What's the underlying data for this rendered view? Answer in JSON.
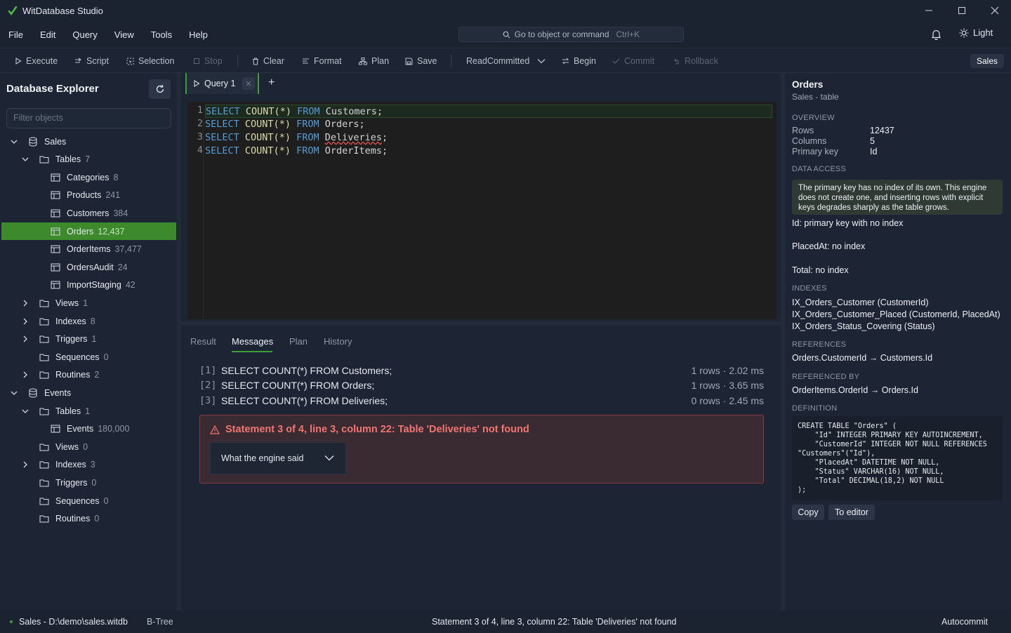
{
  "app": {
    "title": "WitDatabase Studio"
  },
  "menu": [
    "File",
    "Edit",
    "Query",
    "View",
    "Tools",
    "Help"
  ],
  "command_search": {
    "label": "Go to object or command",
    "shortcut": "Ctrl+K"
  },
  "theme_toggle": {
    "label": "Light"
  },
  "toolbar": {
    "execute": "Execute",
    "script": "Script",
    "selection": "Selection",
    "stop": "Stop",
    "clear": "Clear",
    "format": "Format",
    "plan": "Plan",
    "save": "Save",
    "isolation": "ReadCommitted",
    "begin": "Begin",
    "commit": "Commit",
    "rollback": "Rollback",
    "database_badge": "Sales"
  },
  "explorer": {
    "title": "Database Explorer",
    "filter_placeholder": "Filter objects",
    "tree": [
      {
        "label": "Sales",
        "count": ""
      },
      {
        "label": "Tables",
        "count": "7"
      },
      {
        "label": "Categories",
        "count": "8"
      },
      {
        "label": "Products",
        "count": "241"
      },
      {
        "label": "Customers",
        "count": "384"
      },
      {
        "label": "Orders",
        "count": "12,437"
      },
      {
        "label": "OrderItems",
        "count": "37,477"
      },
      {
        "label": "OrdersAudit",
        "count": "24"
      },
      {
        "label": "ImportStaging",
        "count": "42"
      },
      {
        "label": "Views",
        "count": "1"
      },
      {
        "label": "Indexes",
        "count": "8"
      },
      {
        "label": "Triggers",
        "count": "1"
      },
      {
        "label": "Sequences",
        "count": "0"
      },
      {
        "label": "Routines",
        "count": "2"
      },
      {
        "label": "Events",
        "count": ""
      },
      {
        "label": "Tables",
        "count": "1"
      },
      {
        "label": "Events",
        "count": "180,000"
      },
      {
        "label": "Views",
        "count": "0"
      },
      {
        "label": "Indexes",
        "count": "3"
      },
      {
        "label": "Triggers",
        "count": "0"
      },
      {
        "label": "Sequences",
        "count": "0"
      },
      {
        "label": "Routines",
        "count": "0"
      }
    ]
  },
  "editor": {
    "tab_label": "Query 1",
    "line_numbers": [
      "1",
      "2",
      "3",
      "4"
    ],
    "lines": [
      {
        "kw1": "SELECT",
        "fn": "COUNT(*)",
        "kw2": "FROM",
        "table": "Customers",
        "end": ";"
      },
      {
        "kw1": "SELECT",
        "fn": "COUNT(*)",
        "kw2": "FROM",
        "table": "Orders",
        "end": ";"
      },
      {
        "kw1": "SELECT",
        "fn": "COUNT(*)",
        "kw2": "FROM",
        "table": "Deliveries",
        "end": ";"
      },
      {
        "kw1": "SELECT",
        "fn": "COUNT(*)",
        "kw2": "FROM",
        "table": "OrderItems",
        "end": ";"
      }
    ]
  },
  "results": {
    "tabs": [
      "Result",
      "Messages",
      "Plan",
      "History"
    ],
    "messages": [
      {
        "idx": "[1]",
        "sql": "SELECT COUNT(*) FROM Customers;",
        "meta": "1 rows · 2.02 ms"
      },
      {
        "idx": "[2]",
        "sql": "SELECT COUNT(*) FROM Orders;",
        "meta": "1 rows · 3.65 ms"
      },
      {
        "idx": "[3]",
        "sql": "SELECT COUNT(*) FROM Deliveries;",
        "meta": "0 rows · 2.45 ms"
      }
    ],
    "error": {
      "title": "Statement 3 of 4, line 3, column 22: Table 'Deliveries' not found",
      "detail_toggle": "What the engine said"
    }
  },
  "details": {
    "title": "Orders",
    "subtitle": "Sales - table",
    "overview_header": "OVERVIEW",
    "overview": [
      {
        "k": "Rows",
        "v": "12437"
      },
      {
        "k": "Columns",
        "v": "5"
      },
      {
        "k": "Primary key",
        "v": "Id"
      }
    ],
    "data_access_header": "DATA ACCESS",
    "data_access_note": "The primary key has no index of its own. This engine does not create one, and inserting rows with explicit keys degrades sharply as the table grows.",
    "data_access_items": [
      "Id: primary key with no index",
      "PlacedAt: no index",
      "Total: no index"
    ],
    "indexes_header": "INDEXES",
    "indexes": [
      "IX_Orders_Customer (CustomerId)",
      "IX_Orders_Customer_Placed (CustomerId, PlacedAt)",
      "IX_Orders_Status_Covering (Status)"
    ],
    "references_header": "REFERENCES",
    "references": [
      "Orders.CustomerId → Customers.Id"
    ],
    "referenced_by_header": "REFERENCED BY",
    "referenced_by": [
      "OrderItems.OrderId → Orders.Id"
    ],
    "definition_header": "DEFINITION",
    "definition": "CREATE TABLE \"Orders\" (\n    \"Id\" INTEGER PRIMARY KEY AUTOINCREMENT,\n    \"CustomerId\" INTEGER NOT NULL REFERENCES\n\"Customers\"(\"Id\"),\n    \"PlacedAt\" DATETIME NOT NULL,\n    \"Status\" VARCHAR(16) NOT NULL,\n    \"Total\" DECIMAL(18,2) NOT NULL\n);",
    "copy_button": "Copy",
    "to_editor_button": "To editor"
  },
  "status": {
    "connection": "Sales - D:\\demo\\sales.witdb",
    "engine": "B-Tree",
    "message": "Statement 3 of 4, line 3, column 22: Table 'Deliveries' not found",
    "mode": "Autocommit"
  },
  "colors": {
    "accent": "#3d9d3a",
    "selection": "#3d8a2d",
    "error": "#f07671",
    "keyword": "#569cd6",
    "function": "#dcdcaa"
  }
}
